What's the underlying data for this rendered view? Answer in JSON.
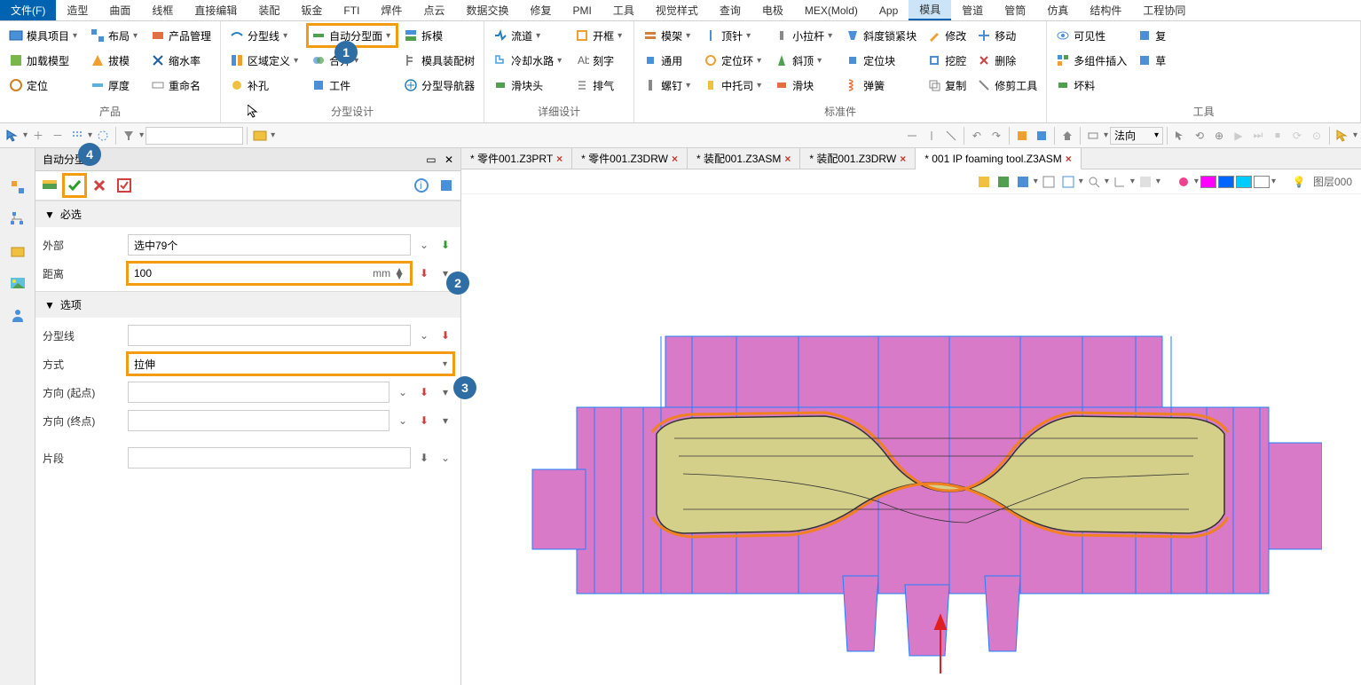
{
  "menu": {
    "file": "文件(F)",
    "items": [
      "造型",
      "曲面",
      "线框",
      "直接编辑",
      "装配",
      "钣金",
      "FTI",
      "焊件",
      "点云",
      "数据交换",
      "修复",
      "PMI",
      "工具",
      "视觉样式",
      "查询",
      "电极",
      "MEX(Mold)",
      "App",
      "模具",
      "管道",
      "管筒",
      "仿真",
      "结构件",
      "工程协同"
    ],
    "active": "模具"
  },
  "ribbon": {
    "groups": [
      {
        "label": "产品",
        "cols": [
          [
            "模具项目",
            "加载模型",
            "定位"
          ],
          [
            "布局",
            "拔模",
            "厚度"
          ],
          [
            "产品管理",
            "缩水率",
            "重命名"
          ]
        ]
      },
      {
        "label": "分型设计",
        "cols": [
          [
            "分型线",
            "区域定义",
            "补孔"
          ],
          [
            "自动分型面",
            "合并",
            "工件"
          ],
          [
            "拆模",
            "模具装配树",
            "分型导航器"
          ]
        ],
        "hl": "自动分型面"
      },
      {
        "label": "详细设计",
        "cols": [
          [
            "流道",
            "冷却水路",
            "滑块头"
          ],
          [
            "开框",
            "刻字",
            "排气"
          ]
        ]
      },
      {
        "label": "标准件",
        "cols": [
          [
            "模架",
            "通用",
            "螺钉"
          ],
          [
            "顶针",
            "定位环",
            "中托司"
          ],
          [
            "小拉杆",
            "斜顶",
            "滑块"
          ],
          [
            "斜度锁紧块",
            "定位块",
            "弹簧"
          ],
          [
            "修改",
            "挖腔",
            "复制"
          ],
          [
            "移动",
            "删除",
            "修剪工具"
          ]
        ]
      },
      {
        "label": "工具",
        "cols": [
          [
            "可见性",
            "多组件插入",
            "坏料"
          ],
          [
            "复",
            "草"
          ]
        ]
      }
    ]
  },
  "qbar": {
    "normal": "法向"
  },
  "panel": {
    "title": "自动分型面",
    "sections": {
      "required": {
        "title": "必选",
        "external_lbl": "外部",
        "external_val": "选中79个",
        "distance_lbl": "距离",
        "distance_val": "100",
        "distance_unit": "mm"
      },
      "options": {
        "title": "选项",
        "pline_lbl": "分型线",
        "method_lbl": "方式",
        "method_val": "拉伸",
        "dir_start_lbl": "方向 (起点)",
        "dir_end_lbl": "方向 (终点)",
        "segment_lbl": "片段"
      }
    }
  },
  "tabs": [
    {
      "label": "* 零件001.Z3PRT",
      "active": false,
      "close": true
    },
    {
      "label": "* 零件001.Z3DRW",
      "active": false,
      "close": true
    },
    {
      "label": "* 装配001.Z3ASM",
      "active": false,
      "close": true
    },
    {
      "label": "* 装配001.Z3DRW",
      "active": false,
      "close": true
    },
    {
      "label": "* 001 IP foaming tool.Z3ASM",
      "active": true,
      "close": true
    }
  ],
  "viewbar": {
    "layer": "图层000"
  },
  "callouts": {
    "c1": "1",
    "c2": "2",
    "c3": "3",
    "c4": "4"
  },
  "colors": {
    "swatches": [
      "#ff00ff",
      "#0066ff",
      "#00ccff",
      "#ffffff"
    ]
  }
}
